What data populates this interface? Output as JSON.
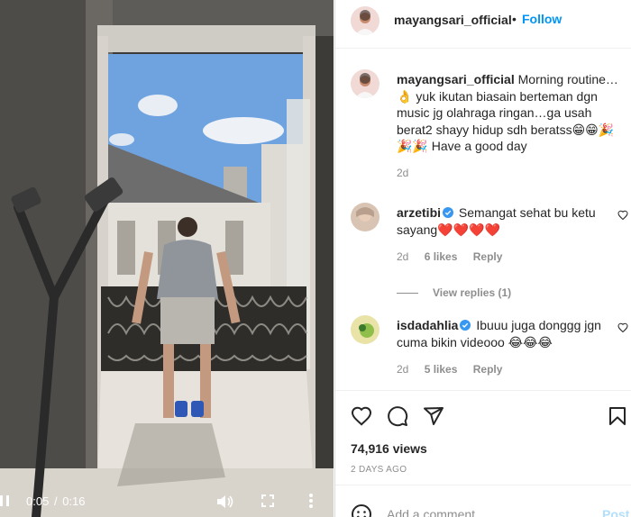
{
  "post": {
    "username": "mayangsari_official",
    "dot": "•",
    "follow_label": "Follow",
    "caption_text": "Morning routine…👌 yuk ikutan biasain berteman dgn music jg olahraga ringan…ga usah berat2 shayy hidup sdh beratss😁😁🎉🎉🎉 Have a good day",
    "caption_age": "2d",
    "views": "74,916 views",
    "date": "2 DAYS AGO"
  },
  "video": {
    "current_time": "0:05",
    "separator": "/",
    "duration": "0:16"
  },
  "comments": [
    {
      "username": "arzetibi",
      "verified": true,
      "text": "Semangat sehat bu ketu sayang❤️❤️❤️❤️",
      "age": "2d",
      "likes": "6 likes",
      "reply_label": "Reply",
      "view_replies": "View replies (1)"
    },
    {
      "username": "isdadahlia",
      "verified": true,
      "text": "Ibuuu juga donggg jgn cuma bikin videooo 😂😂😂",
      "age": "2d",
      "likes": "5 likes",
      "reply_label": "Reply"
    }
  ],
  "composer": {
    "placeholder": "Add a comment…",
    "post_label": "Post"
  },
  "icons": {
    "pause": "pause-icon",
    "volume": "volume-icon",
    "fullscreen": "fullscreen-icon",
    "more": "more-icon",
    "like": "heart-icon",
    "comment": "comment-icon",
    "share": "share-icon",
    "save": "bookmark-icon",
    "emoji": "emoji-icon"
  },
  "colors": {
    "accent": "#0095f6",
    "muted": "#8e8e8e",
    "text": "#262626",
    "verified": "#3897f0",
    "heart_red": "#e0245e"
  }
}
